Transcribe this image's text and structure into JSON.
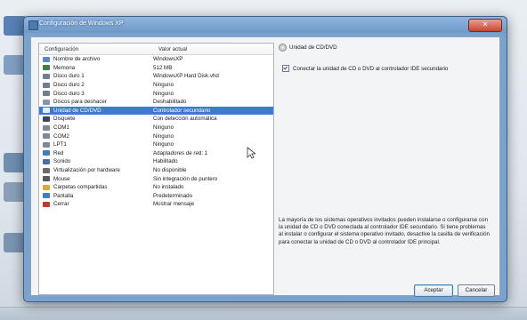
{
  "window": {
    "title": "Configuración de Windows XP"
  },
  "list": {
    "headers": [
      "Configuración",
      "Valor actual"
    ],
    "rows": [
      {
        "name": "Nombre de archivo",
        "value": "WindowsXP",
        "icon": "file-icon",
        "color": "#5b88c9"
      },
      {
        "name": "Memoria",
        "value": "512 MB",
        "icon": "memory-icon",
        "color": "#3f7f3f"
      },
      {
        "name": "Disco duro 1",
        "value": "WindowsXP Hard Disk.vhd",
        "icon": "hard-disk-icon",
        "color": "#6f7f91"
      },
      {
        "name": "Disco duro 2",
        "value": "Ninguno",
        "icon": "hard-disk-icon",
        "color": "#6f7f91"
      },
      {
        "name": "Disco duro 3",
        "value": "Ninguno",
        "icon": "hard-disk-icon",
        "color": "#6f7f91"
      },
      {
        "name": "Discos para deshacer",
        "value": "Deshabilitado",
        "icon": "undo-disk-icon",
        "color": "#8a96a3"
      },
      {
        "name": "Unidad de CD/DVD",
        "value": "Controlador secundario",
        "icon": "cd-icon",
        "color": "#e8eef6",
        "selected": true
      },
      {
        "name": "Disquete",
        "value": "Con detección automática",
        "icon": "floppy-icon",
        "color": "#34495e"
      },
      {
        "name": "COM1",
        "value": "Ninguno",
        "icon": "com-port-icon",
        "color": "#7d8a96"
      },
      {
        "name": "COM2",
        "value": "Ninguno",
        "icon": "com-port-icon",
        "color": "#7d8a96"
      },
      {
        "name": "LPT1",
        "value": "Ninguno",
        "icon": "printer-port-icon",
        "color": "#7d8a96"
      },
      {
        "name": "Red",
        "value": "Adaptadores de red: 1",
        "icon": "network-icon",
        "color": "#3f7fbf"
      },
      {
        "name": "Sonido",
        "value": "Habilitado",
        "icon": "sound-icon",
        "color": "#4a6fa0"
      },
      {
        "name": "Virtualización por hardware",
        "value": "No disponible",
        "icon": "chip-icon",
        "color": "#6d6d6d"
      },
      {
        "name": "Mouse",
        "value": "Sin integración de puntero",
        "icon": "mouse-icon",
        "color": "#5a5a5a"
      },
      {
        "name": "Carpetas compartidas",
        "value": "No instalado",
        "icon": "folder-icon",
        "color": "#d9a93a"
      },
      {
        "name": "Pantalla",
        "value": "Predeterminado",
        "icon": "display-icon",
        "color": "#3a7fc9"
      },
      {
        "name": "Cerrar",
        "value": "Mostrar mensaje",
        "icon": "close-app-icon",
        "color": "#c0392b"
      }
    ]
  },
  "panel": {
    "group_title": "Unidad de CD/DVD",
    "checkbox_label": "Conectar la unidad de CD o DVD al controlador IDE secundario",
    "checkbox_checked": true,
    "note": "La mayoría de los sistemas operativos invitados pueden instalarse o configurarse con la unidad de CD o DVD conectada al controlador IDE secundario. Si tiene problemas al instalar o configurar el sistema operativo invitado, desactive la casilla de verificación para conectar la unidad de CD o DVD al controlador IDE principal."
  },
  "buttons": {
    "ok": "Aceptar",
    "cancel": "Cancelar"
  }
}
